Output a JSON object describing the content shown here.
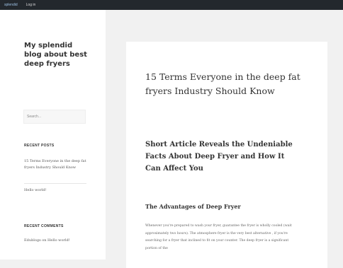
{
  "admin_bar": {
    "logo_text": "splendid",
    "login_label": "Log in"
  },
  "sidebar": {
    "site_title": "My splendid blog about best deep fryers",
    "search_placeholder": "Search...",
    "recent_posts": {
      "title": "RECENT POSTS",
      "items": [
        "15 Terms Everyone in the deep fat fryers Industry Should Know",
        "Hello world!"
      ]
    },
    "recent_comments": {
      "title": "RECENT COMMENTS",
      "items": [
        "Edublogs on Hello world!"
      ]
    }
  },
  "post": {
    "title": "15 Terms Everyone in the deep fat fryers Industry Should Know",
    "heading_1": "Short Article Reveals the Undeniable Facts About Deep Fryer and How It Can Affect You",
    "heading_2": "The Advantages of Deep Fryer",
    "paragraph": "Whenever you're prepared to wash your fryer, guarantee the fryer is wholly cooled (wait approximately two hours). The atmosphere fryer is the very best alternative , if you're searching for a fryer that inclined to fit on your counter. The deep fryer is a significant portion of the"
  }
}
